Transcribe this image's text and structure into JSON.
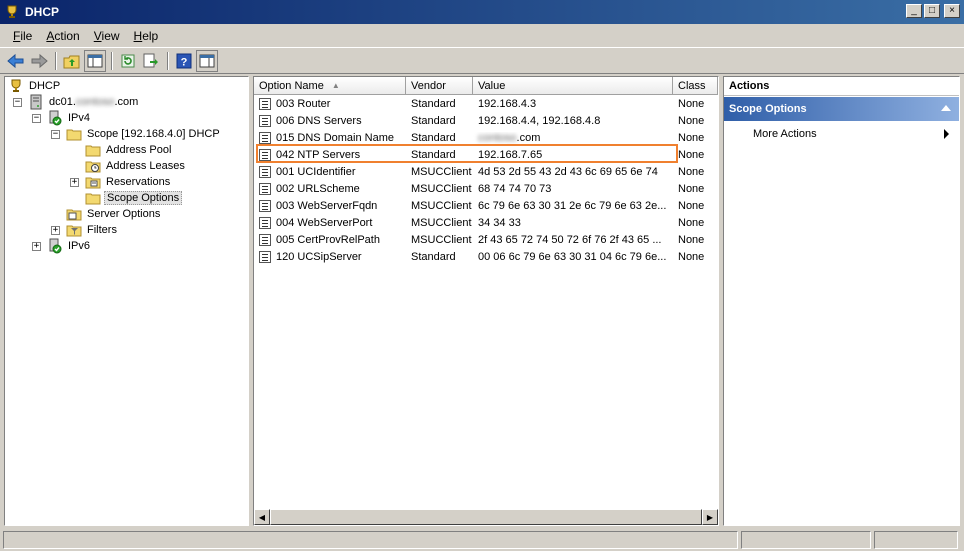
{
  "window": {
    "title": "DHCP"
  },
  "window_buttons": {
    "minimize": "_",
    "maximize": "□",
    "close": "×"
  },
  "menu": [
    {
      "label": "File",
      "accel": "F",
      "rest": "ile"
    },
    {
      "label": "Action",
      "accel": "A",
      "rest": "ction"
    },
    {
      "label": "View",
      "accel": "V",
      "rest": "iew"
    },
    {
      "label": "Help",
      "accel": "H",
      "rest": "elp"
    }
  ],
  "toolbar": {
    "icons": [
      "back-icon",
      "forward-icon",
      "up-folder-icon",
      "show-hide-console-tree-icon",
      "refresh-icon",
      "export-list-icon",
      "help-icon",
      "show-hide-action-pane-icon"
    ]
  },
  "tree": {
    "root": "DHCP",
    "server_prefix": "dc01.",
    "server_blurred": "contoso",
    "server_suffix": ".com",
    "ipv4": "IPv4",
    "scope": "Scope [192.168.4.0] DHCP",
    "address_pool": "Address Pool",
    "address_leases": "Address Leases",
    "reservations": "Reservations",
    "scope_options": "Scope Options",
    "server_options": "Server Options",
    "filters": "Filters",
    "ipv6": "IPv6",
    "expander_minus": "−",
    "expander_plus": "+"
  },
  "list": {
    "columns": {
      "name": "Option Name",
      "vendor": "Vendor",
      "value": "Value",
      "class": "Class"
    },
    "rows": [
      {
        "name": "003 Router",
        "vendor": "Standard",
        "value": "192.168.4.3",
        "class": "None"
      },
      {
        "name": "006 DNS Servers",
        "vendor": "Standard",
        "value": "192.168.4.4, 192.168.4.8",
        "class": "None"
      },
      {
        "name": "015 DNS Domain Name",
        "vendor": "Standard",
        "value_blurred": "contoso",
        "value_suffix": ".com",
        "class": "None"
      },
      {
        "name": "042 NTP Servers",
        "vendor": "Standard",
        "value": "192.168.7.65",
        "class": "None"
      },
      {
        "name": "001 UCIdentifier",
        "vendor": "MSUCClient",
        "value": "4d 53 2d 55 43 2d 43 6c 69 65 6e 74",
        "class": "None"
      },
      {
        "name": "002 URLScheme",
        "vendor": "MSUCClient",
        "value": "68 74 74 70 73",
        "class": "None"
      },
      {
        "name": "003 WebServerFqdn",
        "vendor": "MSUCClient",
        "value": "6c 79 6e 63 30 31 2e 6c 79 6e 63 2e...",
        "class": "None"
      },
      {
        "name": "004 WebServerPort",
        "vendor": "MSUCClient",
        "value": "34 34 33",
        "class": "None"
      },
      {
        "name": "005 CertProvRelPath",
        "vendor": "MSUCClient",
        "value": "2f 43 65 72 74 50 72 6f 76 2f 43 65 ...",
        "class": "None"
      },
      {
        "name": "120 UCSipServer",
        "vendor": "Standard",
        "value": "00 06 6c 79 6e 63 30 31 04 6c 79 6e...",
        "class": "None"
      }
    ],
    "highlighted_row": "042 NTP Servers",
    "highlight_color": "#f0802f"
  },
  "actions": {
    "header": "Actions",
    "group": "Scope Options",
    "items": [
      "More Actions"
    ]
  },
  "colors": {
    "titlebar_start": "#0a246a",
    "titlebar_end": "#3a6ea5",
    "actions_group_start": "#2f5ea8"
  }
}
